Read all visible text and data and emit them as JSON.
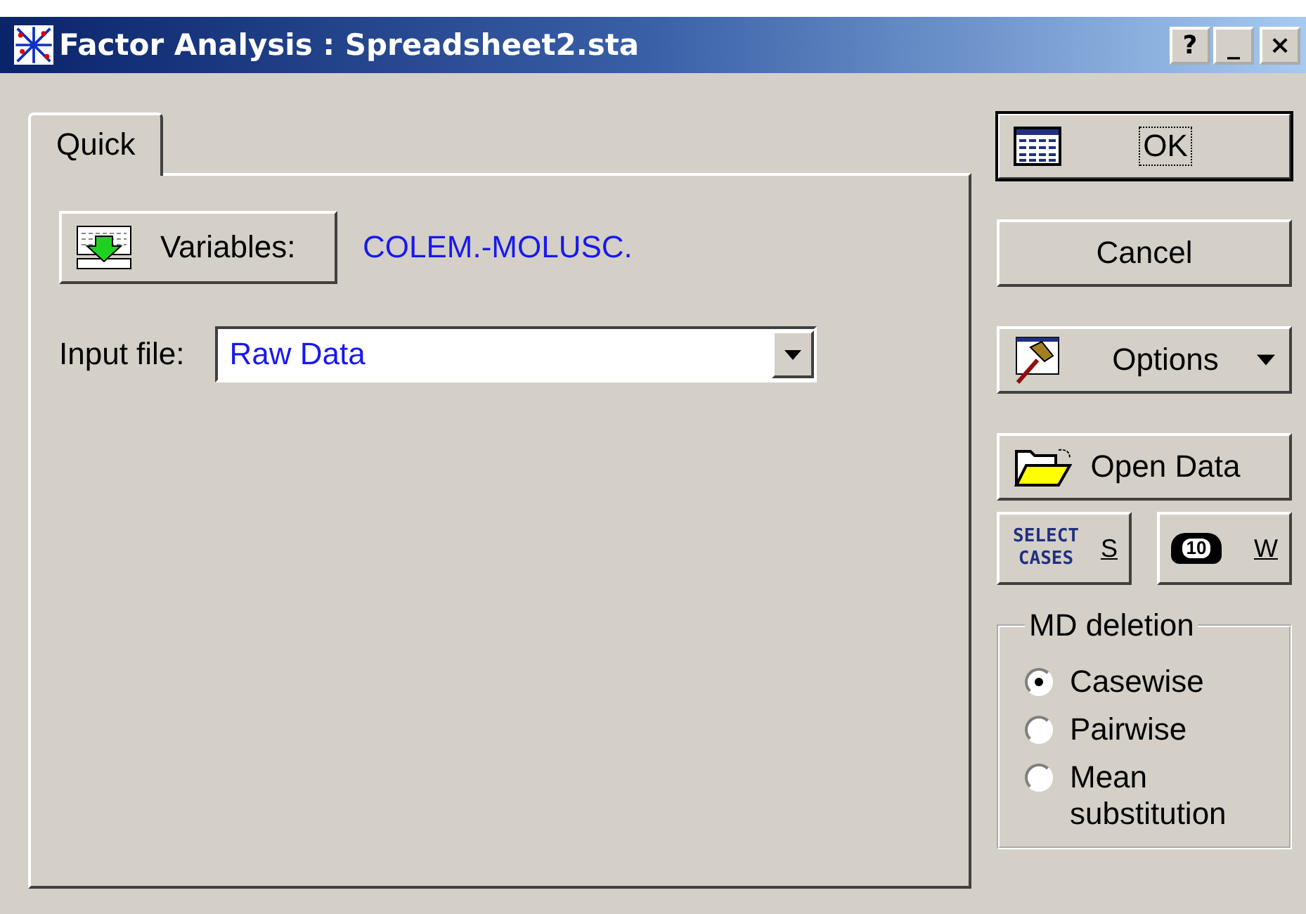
{
  "window": {
    "title": "Factor Analysis : Spreadsheet2.sta",
    "title_buttons": [
      "?",
      "_",
      "×"
    ]
  },
  "tabs": [
    {
      "label": "Quick",
      "selected": true
    }
  ],
  "variables": {
    "button": "Variables:",
    "value": "COLEM.-MOLUSC."
  },
  "input_file": {
    "label": "Input file:",
    "value": "Raw Data"
  },
  "buttons": [
    {
      "kind": "ok",
      "label": "OK"
    },
    {
      "kind": "plain",
      "label": "Cancel"
    },
    {
      "kind": "options",
      "label": "Options"
    },
    {
      "kind": "open",
      "label": "Open Data"
    }
  ],
  "small_buttons": [
    {
      "kind": "select",
      "icon_text": "SELECT CASES",
      "label": "S"
    },
    {
      "kind": "weight",
      "icon_text": "10",
      "label": "W"
    }
  ],
  "md_deletion": {
    "title": "MD deletion",
    "options": [
      {
        "label": "Casewise",
        "selected": true
      },
      {
        "label": "Pairwise",
        "selected": false
      },
      {
        "label": "Mean substitution",
        "selected": false
      }
    ]
  }
}
